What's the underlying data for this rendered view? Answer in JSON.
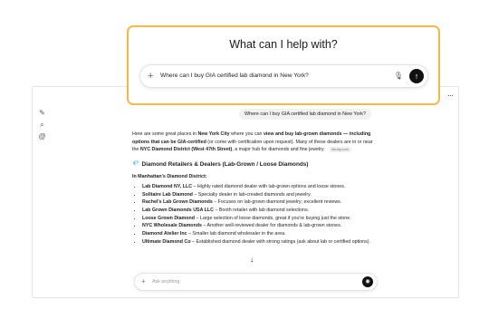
{
  "prompt_card": {
    "heading": "What can I help with?",
    "input_value": "Where can I buy GIA certified lab diamond in New York?",
    "plus_icon": "+",
    "mic_icon": "🎙",
    "send_icon": "↑"
  },
  "chat": {
    "more_icon": "···",
    "rail": {
      "edit_icon": "✎",
      "search_icon": "⌕",
      "link_icon": "@"
    },
    "user_message": "Where can I buy GIA certified lab diamond in New York?",
    "intro": {
      "t1": "Here are some great places in ",
      "b1": "New York City",
      "t2": " where you can ",
      "b2": "view and buy lab-grown diamonds — including options that can be GIA-certified",
      "t3": " (or come with certification upon request). Many of these dealers are in or near the ",
      "b3": "NYC Diamond District (West 47th Street)",
      "t4": ", a major hub for diamonds and fine jewelry.",
      "source": "libraly.com"
    },
    "section_icon": "💎",
    "section_title": "Diamond Retailers & Dealers (Lab-Grown / Loose Diamonds)",
    "subhead": "In Manhattan's Diamond District:",
    "stores": [
      {
        "name": "Lab Diamond NY, LLC",
        "desc": " – Highly rated diamond dealer with lab-grown options and loose stones."
      },
      {
        "name": "Solitaire Lab Diamond",
        "desc": " – Specialty dealer in lab-created diamonds and jewelry."
      },
      {
        "name": "Rachel's Lab Grown Diamonds",
        "desc": " – Focuses on lab-grown diamond jewelry; excellent reviews."
      },
      {
        "name": "Lab Grown Diamonds USA LLC",
        "desc": " – Booth retailer with lab diamond selections."
      },
      {
        "name": "Loose Grown Diamond",
        "desc": " – Large selection of loose diamonds, great if you're buying just the stone."
      },
      {
        "name": "NYC Wholesale Diamonds",
        "desc": " – Another well-reviewed dealer for diamonds & lab-grown stones."
      },
      {
        "name": "Diamond Atelier Inc",
        "desc": " – Smaller lab diamond wholesaler in the area."
      },
      {
        "name": "Ultimate Diamond Co",
        "desc": " – Established diamond dealer with strong ratings (ask about lab or certified options)."
      }
    ],
    "bottom_input": {
      "placeholder": "Ask anything",
      "plus_icon": "+",
      "voice_icon": "◉"
    }
  },
  "cursor_icon": "↓"
}
